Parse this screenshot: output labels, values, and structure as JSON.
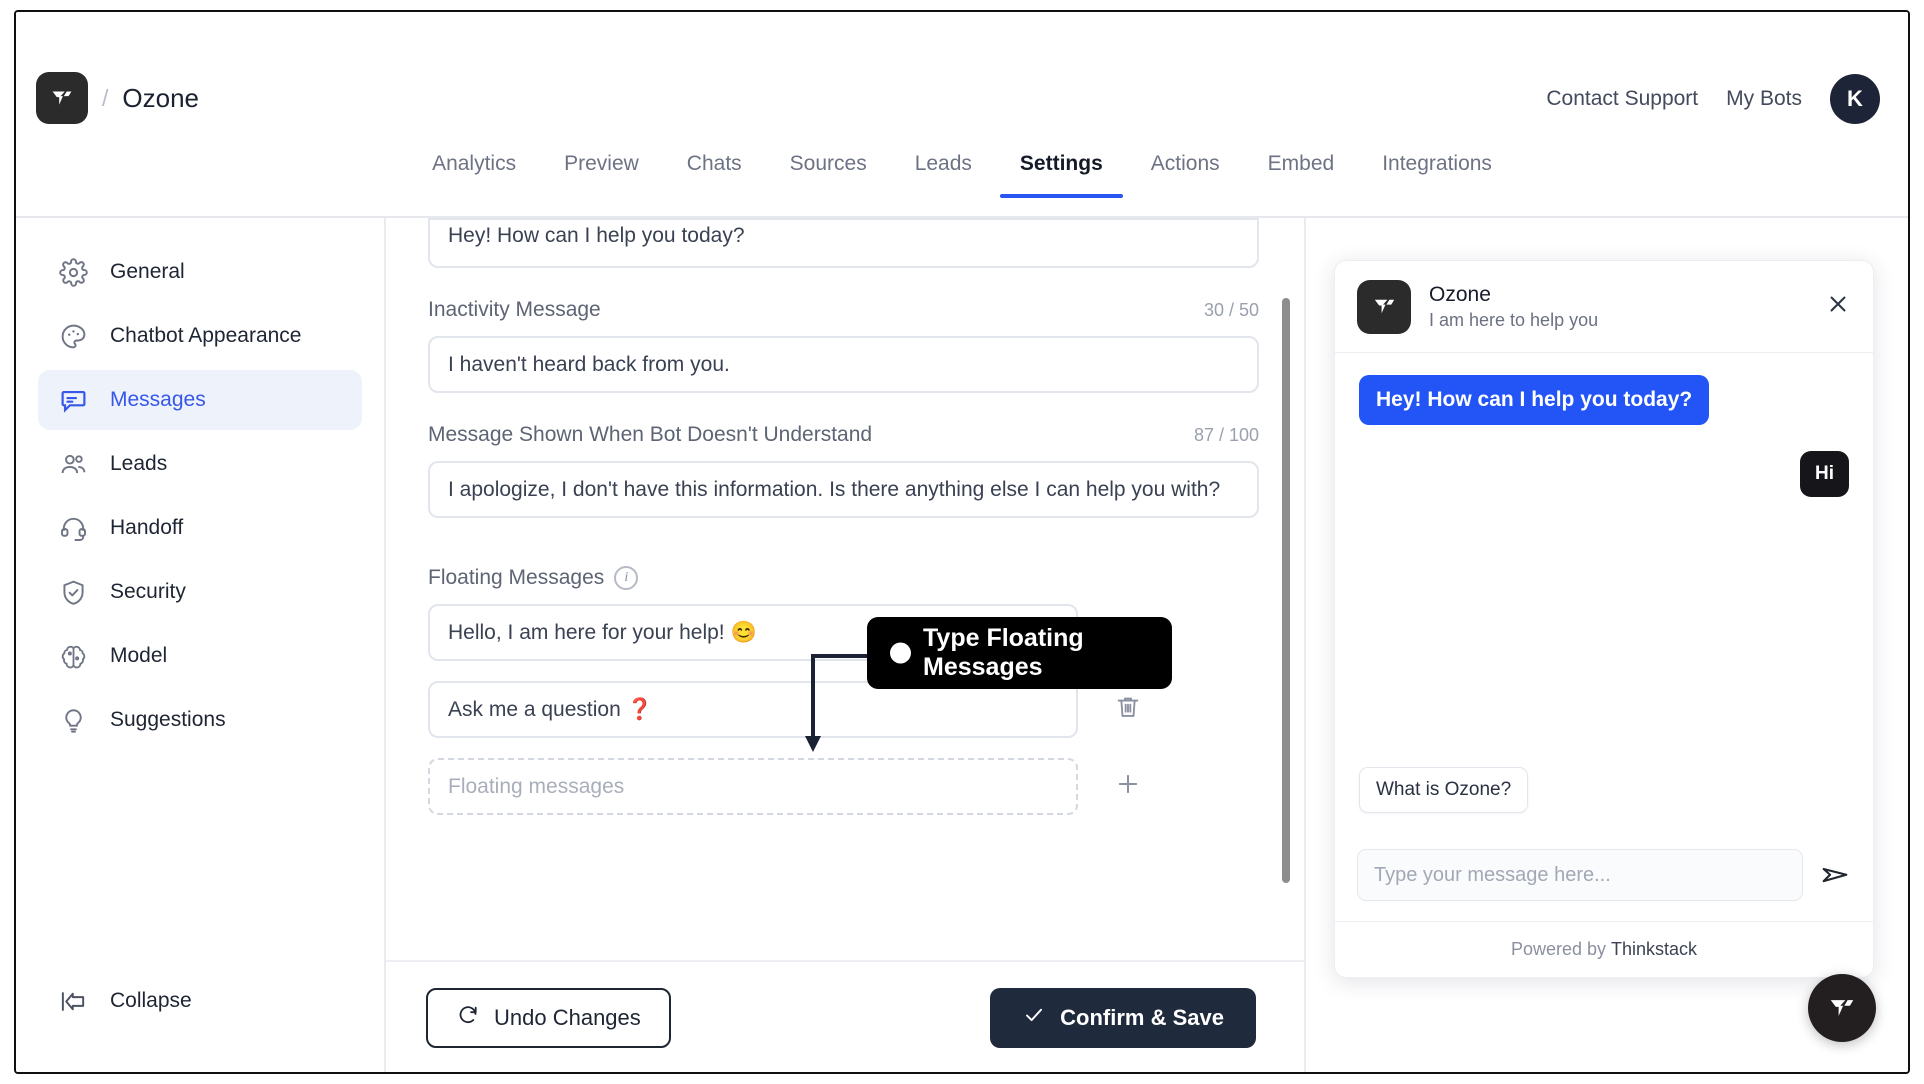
{
  "header": {
    "brand_logo_icon": "thinkstack-logo-icon",
    "separator": "/",
    "bot_name": "Ozone",
    "contact_support": "Contact Support",
    "my_bots": "My Bots",
    "avatar_initial": "K"
  },
  "tabs": [
    {
      "label": "Analytics",
      "active": false
    },
    {
      "label": "Preview",
      "active": false
    },
    {
      "label": "Chats",
      "active": false
    },
    {
      "label": "Sources",
      "active": false
    },
    {
      "label": "Leads",
      "active": false
    },
    {
      "label": "Settings",
      "active": true
    },
    {
      "label": "Actions",
      "active": false
    },
    {
      "label": "Embed",
      "active": false
    },
    {
      "label": "Integrations",
      "active": false
    }
  ],
  "sidebar": {
    "items": [
      {
        "label": "General",
        "icon": "gear-icon",
        "active": false
      },
      {
        "label": "Chatbot Appearance",
        "icon": "palette-icon",
        "active": false
      },
      {
        "label": "Messages",
        "icon": "message-icon",
        "active": true
      },
      {
        "label": "Leads",
        "icon": "users-icon",
        "active": false
      },
      {
        "label": "Handoff",
        "icon": "headset-icon",
        "active": false
      },
      {
        "label": "Security",
        "icon": "shield-check-icon",
        "active": false
      },
      {
        "label": "Model",
        "icon": "brain-icon",
        "active": false
      },
      {
        "label": "Suggestions",
        "icon": "bulb-icon",
        "active": false
      }
    ],
    "collapse_label": "Collapse",
    "collapse_icon": "collapse-left-icon"
  },
  "form": {
    "welcome_value": "Hey! How can I help you today?",
    "inactivity_label": "Inactivity Message",
    "inactivity_count": "30 / 50",
    "inactivity_value": "I haven't heard back from you.",
    "fallback_label": "Message Shown When Bot Doesn't Understand",
    "fallback_count": "87 / 100",
    "fallback_value": "I apologize, I don't have this information. Is there anything else I can help you with?",
    "floating_label": "Floating Messages",
    "floating_messages": [
      {
        "value": "Hello, I am here for your help! 😊",
        "action_icon": "trash-icon"
      },
      {
        "value": "Ask me a question ❓",
        "action_icon": "trash-icon"
      }
    ],
    "floating_placeholder": "Floating messages",
    "add_icon": "plus-icon",
    "undo_label": "Undo Changes",
    "undo_icon": "refresh-icon",
    "save_label": "Confirm & Save",
    "save_icon": "check-icon"
  },
  "callout": {
    "line1": "Type Floating",
    "line2": "Messages"
  },
  "preview": {
    "title": "Ozone",
    "subtitle": "I am here to help you",
    "close_icon": "close-icon",
    "bot_message": "Hey! How can I help you today?",
    "user_message": "Hi",
    "suggestion": "What is Ozone?",
    "input_placeholder": "Type your message here...",
    "send_icon": "send-icon",
    "powered_by": "Powered by",
    "powered_brand": "Thinkstack",
    "fab_icon": "thinkstack-logo-icon"
  },
  "colors": {
    "accent": "#2955f0",
    "bot_bubble": "#2355f6",
    "user_bubble": "#16161a",
    "dark": "#1f2a3c"
  }
}
